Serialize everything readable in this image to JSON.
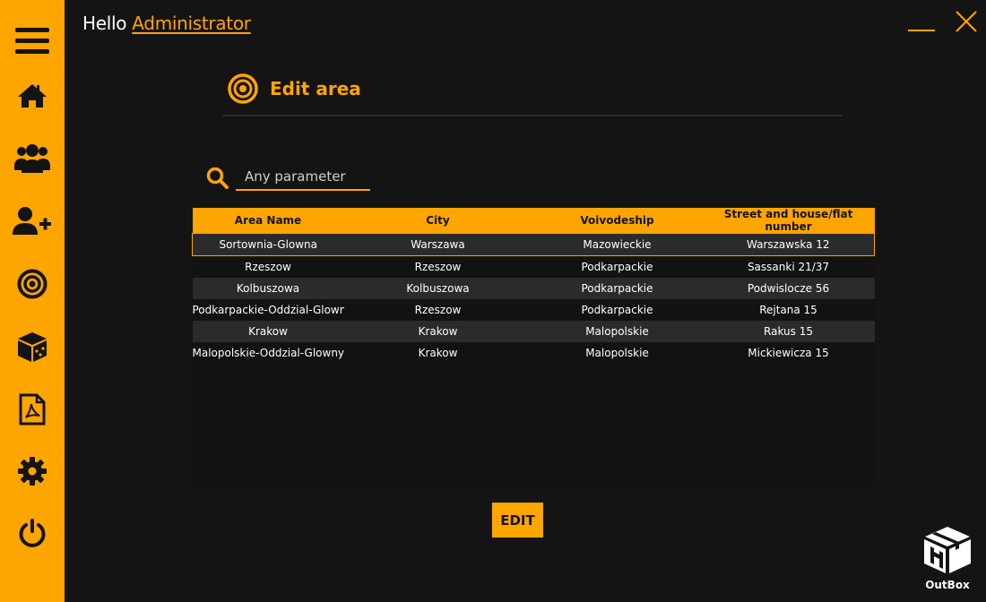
{
  "header": {
    "greeting": "Hello",
    "username": "Administrator"
  },
  "sidebar": {
    "items": [
      {
        "icon": "menu-icon"
      },
      {
        "icon": "home-icon"
      },
      {
        "icon": "users-icon"
      },
      {
        "icon": "add-user-icon"
      },
      {
        "icon": "target-icon"
      },
      {
        "icon": "package-icon"
      },
      {
        "icon": "pdf-icon"
      },
      {
        "icon": "settings-icon"
      },
      {
        "icon": "power-icon"
      }
    ]
  },
  "page": {
    "title": "Edit area"
  },
  "search": {
    "placeholder": "Any parameter",
    "value": ""
  },
  "table": {
    "columns": [
      "Area Name",
      "City",
      "Voivodeship",
      "Street and house/flat number"
    ],
    "rows": [
      [
        "Sortownia-Glowna",
        "Warszawa",
        "Mazowieckie",
        "Warszawska 12"
      ],
      [
        "Rzeszow",
        "Rzeszow",
        "Podkarpackie",
        "Sassanki 21/37"
      ],
      [
        "Kolbuszowa",
        "Kolbuszowa",
        "Podkarpackie",
        "Podwislocze 56"
      ],
      [
        "Podkarpackie-Oddzial-Glowny",
        "Rzeszow",
        "Podkarpackie",
        "Rejtana 15"
      ],
      [
        "Krakow",
        "Krakow",
        "Malopolskie",
        "Rakus 15"
      ],
      [
        "Malopolskie-Oddzial-Glowny",
        "Krakow",
        "Malopolskie",
        "Mickiewicza 15"
      ]
    ],
    "selected_row": 0
  },
  "actions": {
    "edit_label": "EDIT"
  },
  "logo": {
    "text": "OutBox"
  },
  "colors": {
    "accent": "#FFA500",
    "background": "#141414",
    "row_alt": "#2B2B2B"
  }
}
